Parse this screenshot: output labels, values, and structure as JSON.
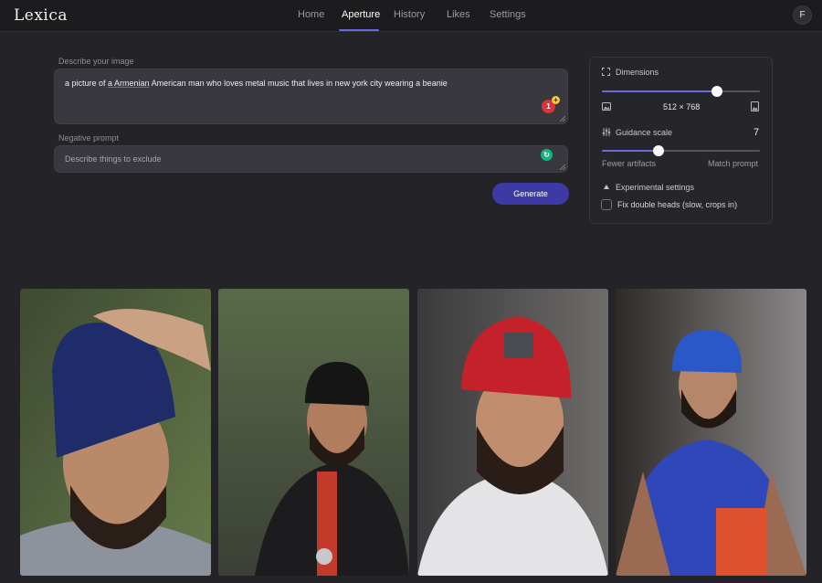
{
  "header": {
    "logo": "Lexica",
    "nav": [
      {
        "label": "Home",
        "active": false
      },
      {
        "label": "Aperture",
        "active": true
      },
      {
        "label": "History",
        "active": false
      },
      {
        "label": "Likes",
        "active": false
      },
      {
        "label": "Settings",
        "active": false
      }
    ],
    "avatar_initial": "F"
  },
  "prompt": {
    "label": "Describe your image",
    "text_before": "a picture of ",
    "text_misspelled": "a Armenian",
    "text_after": " American man who loves metal music that lives in new york city wearing a beanie",
    "grammar_count": "1"
  },
  "negative_prompt": {
    "label": "Negative prompt",
    "placeholder": "Describe things to exclude"
  },
  "generate_label": "Generate",
  "settings": {
    "dimensions_label": "Dimensions",
    "dimensions_value": "512 × 768",
    "dimensions_slider_fraction": 0.73,
    "guidance_label": "Guidance scale",
    "guidance_value": "7",
    "guidance_slider_fraction": 0.36,
    "fewer_artifacts_label": "Fewer artifacts",
    "match_prompt_label": "Match prompt",
    "experimental_label": "Experimental settings",
    "fix_double_heads_label": "Fix double heads (slow, crops in)",
    "fix_double_heads_checked": false
  },
  "colors": {
    "accent": "#6a6ae0",
    "button": "#3d3aa6",
    "background": "#242428"
  },
  "icons": [
    "expand-icon",
    "portrait-icon",
    "landscape-icon",
    "sliders-icon",
    "caret-up-icon",
    "grammarly-icon"
  ]
}
